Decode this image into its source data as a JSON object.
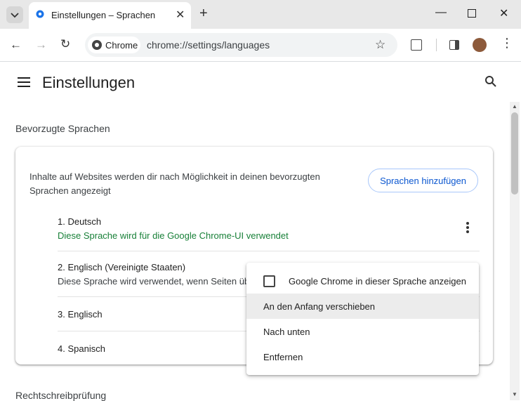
{
  "browser": {
    "tab_title": "Einstellungen – Sprachen",
    "chip_label": "Chrome",
    "url": "chrome://settings/languages"
  },
  "settings": {
    "title": "Einstellungen",
    "section_preferred": "Bevorzugte Sprachen",
    "card_description": "Inhalte auf Websites werden dir nach Möglichkeit in deinen bevorzugten Sprachen angezeigt",
    "add_languages_label": "Sprachen hinzufügen",
    "languages": [
      {
        "name": "1. Deutsch",
        "note": "Diese Sprache wird für die Google Chrome-UI verwendet"
      },
      {
        "name": "2. Englisch (Vereinigte Staaten)",
        "note": "Diese Sprache wird verwendet, wenn Seiten übersetzt werden"
      },
      {
        "name": "3. Englisch",
        "note": ""
      },
      {
        "name": "4. Spanisch",
        "note": ""
      }
    ],
    "section_spellcheck": "Rechtschreibprüfung"
  },
  "context_menu": {
    "show_ui_label": "Google Chrome in dieser Sprache anzeigen",
    "move_top_label": "An den Anfang verschieben",
    "move_down_label": "Nach unten",
    "remove_label": "Entfernen"
  },
  "colors": {
    "accent_blue": "#0b57d0",
    "ui_language_green": "#188038"
  }
}
